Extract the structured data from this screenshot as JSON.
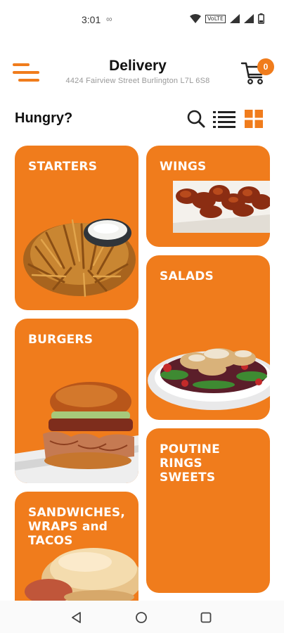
{
  "status_bar": {
    "time": "3:01",
    "infinity": "∞",
    "network_label": "VoLTE"
  },
  "header": {
    "title": "Delivery",
    "address": "4424 Fairview Street   Burlington L7L 6S8",
    "cart_count": "0"
  },
  "toolbar": {
    "heading": "Hungry?"
  },
  "categories": [
    {
      "label": "STARTERS"
    },
    {
      "label": "WINGS"
    },
    {
      "label": "SALADS"
    },
    {
      "label": "BURGERS"
    },
    {
      "label": "POUTINE\nRINGS\nSWEETS"
    },
    {
      "label": "SANDWICHES,\nWRAPS and\nTACOS"
    }
  ],
  "colors": {
    "accent": "#f07c1c",
    "text": "#111111",
    "muted": "#999999"
  },
  "icons": {
    "menu": "hamburger-menu-icon",
    "cart": "cart-icon",
    "search": "search-icon",
    "list": "list-view-icon",
    "grid": "grid-view-icon",
    "back": "back-icon",
    "home": "home-icon",
    "recent": "recent-apps-icon"
  }
}
